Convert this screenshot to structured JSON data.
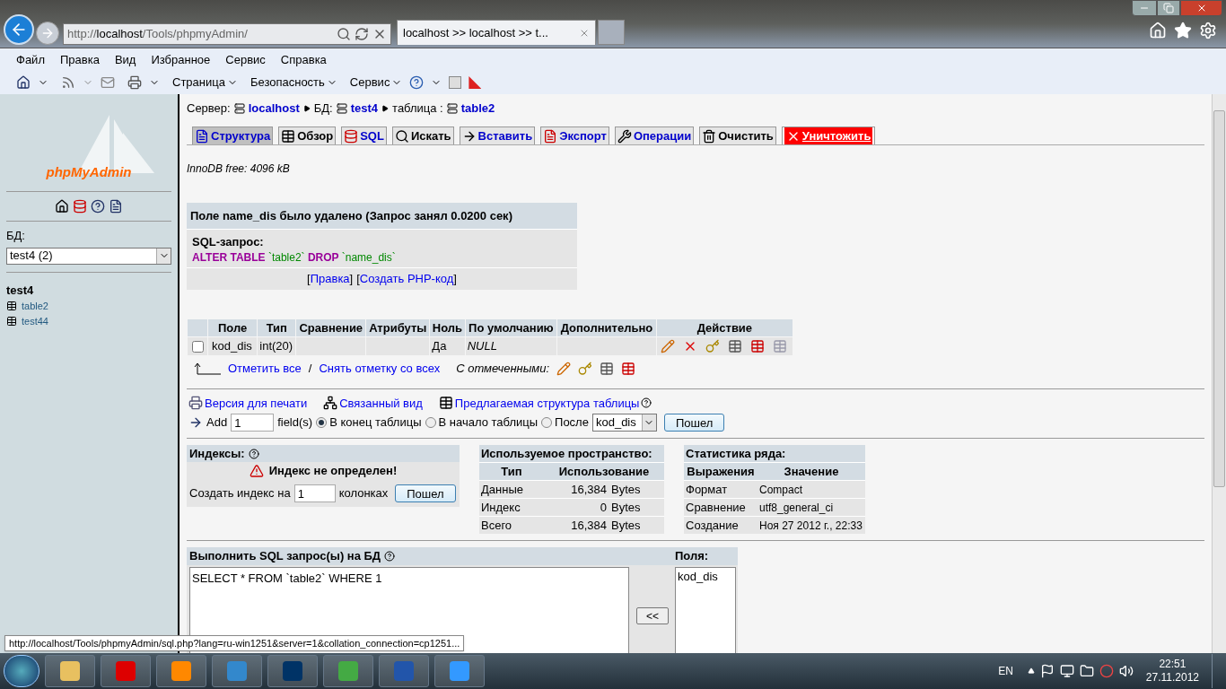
{
  "browser": {
    "address_prefix": "http://",
    "address_host": "localhost",
    "address_path": "/Tools/phpmyAdmin/",
    "tab_title": "localhost >> localhost >> t..."
  },
  "menu": [
    "Файл",
    "Правка",
    "Вид",
    "Избранное",
    "Сервис",
    "Справка"
  ],
  "toolbar_menus": [
    "Страница",
    "Безопасность",
    "Сервис"
  ],
  "sidebar": {
    "logo": "phpMyAdmin",
    "db_label": "БД:",
    "db_select": "test4 (2)",
    "db_name": "test4",
    "tables": [
      "table2",
      "test44"
    ]
  },
  "breadcrumb": [
    {
      "label": "Сервер:",
      "value": "localhost"
    },
    {
      "label": "БД:",
      "value": "test4"
    },
    {
      "label": "таблица :",
      "value": "table2"
    }
  ],
  "tabs": [
    {
      "label": "Структура",
      "selected": true,
      "kind": "normal"
    },
    {
      "label": "Обзор",
      "selected": false,
      "kind": "normal"
    },
    {
      "label": "SQL",
      "selected": false,
      "kind": "normal"
    },
    {
      "label": "Искать",
      "selected": false,
      "kind": "normal"
    },
    {
      "label": "Вставить",
      "selected": false,
      "kind": "normal"
    },
    {
      "label": "Экспорт",
      "selected": false,
      "kind": "normal"
    },
    {
      "label": "Операции",
      "selected": false,
      "kind": "normal"
    },
    {
      "label": "Очистить",
      "selected": false,
      "kind": "normal"
    },
    {
      "label": "Уничтожить",
      "selected": false,
      "kind": "danger"
    }
  ],
  "innodb": "InnoDB free: 4096 kB",
  "message": {
    "title": "Поле name_dis было удалено (Запрос занял 0.0200 сек)",
    "sql_label": "SQL-запрос:",
    "sql": [
      {
        "text": "ALTER TABLE",
        "kind": "keyword"
      },
      {
        "text": "`table2`",
        "kind": "name"
      },
      {
        "text": "DROP",
        "kind": "keyword"
      },
      {
        "text": "`name_dis`",
        "kind": "name"
      }
    ],
    "links": [
      {
        "prefix": "[",
        "label": "Правка",
        "suffix": "]"
      },
      {
        "prefix": "[",
        "label": "Создать PHP-код",
        "suffix": "]"
      }
    ]
  },
  "structure": {
    "columns": [
      "Поле",
      "Тип",
      "Сравнение",
      "Атрибуты",
      "Ноль",
      "По умолчанию",
      "Дополнительно",
      "Действие"
    ],
    "rows": [
      {
        "checked": false,
        "field": "kod_dis",
        "type": "int(20)",
        "null": "Да",
        "default": "NULL"
      }
    ],
    "check_all": "Отметить все",
    "separator": "/",
    "uncheck_all": "Снять отметку со всех",
    "with_selected": "С отмеченными:"
  },
  "links": [
    "Версия для печати",
    "Связанный вид",
    "Предлагаемая структура таблицы"
  ],
  "add_field": {
    "label": "Add",
    "value": "1",
    "unit": "field(s)",
    "positions": [
      {
        "label": "В конец таблицы",
        "selected": true
      },
      {
        "label": "В начало таблицы",
        "selected": false
      },
      {
        "label": "После",
        "selected": false
      }
    ],
    "after": "kod_dis",
    "button": "Пошел"
  },
  "indexes": {
    "title": "Индексы:",
    "warning": "Индекс не определен!",
    "create_label": "Создать индекс на",
    "value": "1",
    "unit": "колонках",
    "button": "Пошел"
  },
  "space": {
    "title": "Используемое пространство:",
    "columns": [
      "Тип",
      "Использование"
    ],
    "rows": [
      {
        "type": "Данные",
        "value": "16,384",
        "unit": "Bytes"
      },
      {
        "type": "Индекс",
        "value": "0",
        "unit": "Bytes"
      },
      {
        "type": "Всего",
        "value": "16,384",
        "unit": "Bytes"
      }
    ]
  },
  "row_stats": {
    "title": "Статистика ряда:",
    "columns": [
      "Выражения",
      "Значение"
    ],
    "rows": [
      {
        "name": "Формат",
        "value": "Compact"
      },
      {
        "name": "Сравнение",
        "value": "utf8_general_ci"
      },
      {
        "name": "Создание",
        "value": "Ноя 27 2012 г., 22:33"
      }
    ]
  },
  "sql_box": {
    "title": "Выполнить SQL запрос(ы) на БД",
    "query": "SELECT * FROM `table2` WHERE 1",
    "insert_button": "<<",
    "fields_title": "Поля:",
    "fields": [
      "kod_dis"
    ]
  },
  "status_url": "http://localhost/Tools/phpmyAdmin/sql.php?lang=ru-win1251&server=1&collation_connection=cp1251...",
  "taskbar": {
    "language": "EN",
    "time": "22:51",
    "date": "27.11.2012"
  }
}
